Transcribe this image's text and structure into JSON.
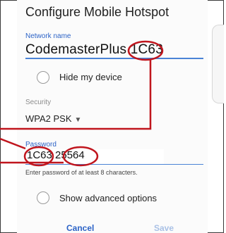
{
  "dialog": {
    "title": "Configure Mobile Hotspot",
    "network_name_label": "Network name",
    "network_name_base": "CodemasterPlus",
    "network_name_suffix": "1C63",
    "hide_device_label": "Hide my device",
    "security_label": "Security",
    "security_value": "WPA2 PSK",
    "password_label": "Password",
    "password_prefix": "1C63",
    "password_suffix": "25564",
    "password_hint": "Enter password of at least 8 characters.",
    "advanced_options_label": "Show advanced options",
    "cancel_label": "Cancel",
    "save_label": "Save"
  },
  "colors": {
    "accent": "#2c63c7",
    "annotation": "#c0151d",
    "save_disabled": "#a9c1e6"
  }
}
